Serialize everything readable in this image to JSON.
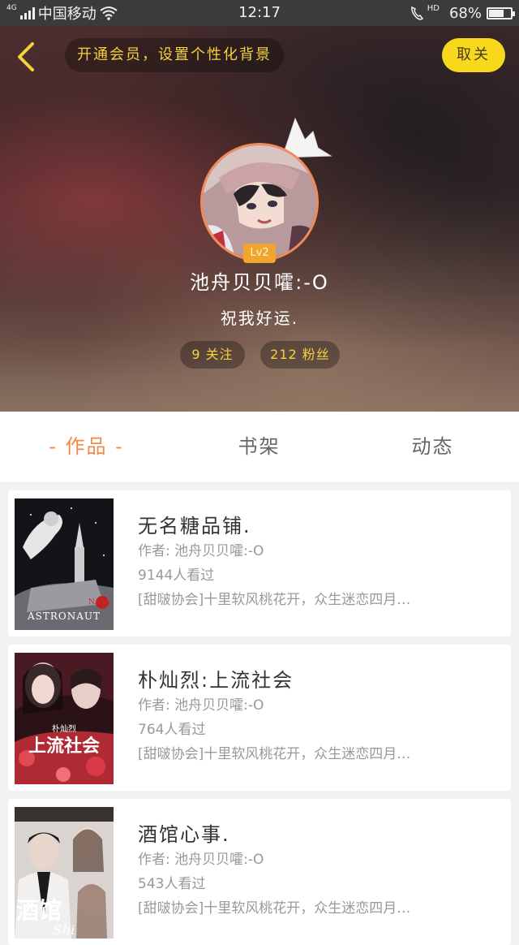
{
  "status_bar": {
    "network": "4G",
    "carrier": "中国移动",
    "time": "12:17",
    "hd": "HD",
    "battery": "68%",
    "battery_level": 0.68
  },
  "header": {
    "vip_banner": "开通会员，设置个性化背景",
    "follow_label": "取关",
    "level": "Lv2",
    "username": "池舟贝贝嚯:-O",
    "signature": "祝我好运.",
    "following": "9 关注",
    "fans": "212 粉丝",
    "colors": {
      "accent_yellow": "#f7d81b",
      "avatar_border": "#f08c5a",
      "badge": "#f0a52e"
    }
  },
  "tabs": [
    {
      "label": "- 作品 -",
      "active": true
    },
    {
      "label": "书架",
      "active": false
    },
    {
      "label": "动态",
      "active": false
    }
  ],
  "books": [
    {
      "title": "无名糖品铺.",
      "author": "作者: 池舟贝贝嚯:-O",
      "views": "9144人看过",
      "desc": "[甜啵协会]十里软风桃花开，众生迷恋四月…",
      "cover_text": "ASTRONAUT",
      "cover_sub": "NASA"
    },
    {
      "title": "朴灿烈:上流社会",
      "author": "作者: 池舟贝贝嚯:-O",
      "views": "764人看过",
      "desc": "[甜啵协会]十里软风桃花开，众生迷恋四月…",
      "cover_text": "上流社会",
      "cover_sub": "朴灿烈"
    },
    {
      "title": "酒馆心事.",
      "author": "作者: 池舟贝贝嚯:-O",
      "views": "543人看过",
      "desc": "[甜啵协会]十里软风桃花开，众生迷恋四月…",
      "cover_text": "酒馆",
      "cover_sub": "Shi"
    }
  ]
}
